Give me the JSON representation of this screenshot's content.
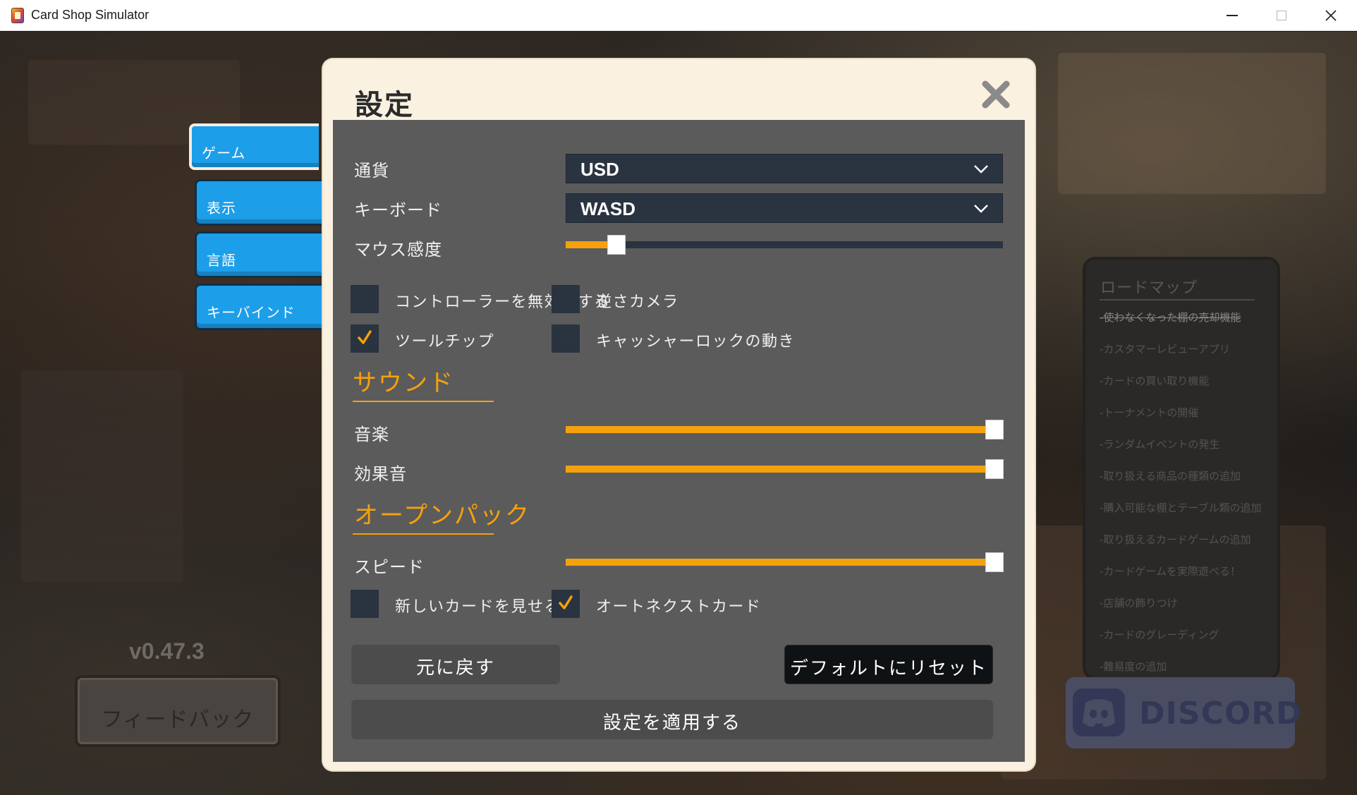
{
  "window": {
    "title": "Card Shop Simulator"
  },
  "tabs": [
    {
      "label": "ゲーム",
      "active": true
    },
    {
      "label": "表示",
      "active": false
    },
    {
      "label": "言語",
      "active": false
    },
    {
      "label": "キーバインド",
      "active": false
    }
  ],
  "version": "v0.47.3",
  "feedback_label": "フィードバック",
  "roadmap": {
    "title": "ロードマップ",
    "items": [
      "-使わなくなった棚の売却機能",
      "-カスタマーレビューアプリ",
      "-カードの買い取り機能",
      "-トーナメントの開催",
      "-ランダムイベントの発生",
      "-取り扱える商品の種類の追加",
      "-購入可能な棚とテーブル類の追加",
      "-取り扱えるカードゲームの追加",
      "-カードゲームを実際遊べる！",
      "-店舗の飾りつけ",
      "-カードのグレーディング",
      "-難易度の追加"
    ]
  },
  "discord_label": "DISCORD",
  "settings": {
    "title": "設定",
    "currency": {
      "label": "通貨",
      "value": "USD"
    },
    "keyboard": {
      "label": "キーボード",
      "value": "WASD"
    },
    "mouse_sensitivity": {
      "label": "マウス感度",
      "level": 0.1
    },
    "disable_controller": {
      "label": "コントローラーを無効にする",
      "checked": false
    },
    "invert_camera": {
      "label": "逆さカメラ",
      "checked": false
    },
    "tooltip": {
      "label": "ツールチップ",
      "checked": true
    },
    "cashier_lock": {
      "label": "キャッシャーロックの動き",
      "checked": false
    },
    "sound_section": "サウンド",
    "music": {
      "label": "音楽",
      "level": 1.0
    },
    "sfx": {
      "label": "効果音",
      "level": 1.0
    },
    "open_pack_section": "オープンパック",
    "speed": {
      "label": "スピード",
      "level": 1.0
    },
    "show_new_cards": {
      "label": "新しいカードを見せる",
      "checked": false
    },
    "auto_next_card": {
      "label": "オートネクストカード",
      "checked": true
    },
    "revert_label": "元に戻す",
    "reset_label": "デフォルトにリセット",
    "apply_label": "設定を適用する"
  },
  "colors": {
    "accent": "#f5a10c",
    "tab_blue": "#1d9ee9",
    "panel": "#5b5b5b",
    "control_dark": "#2a3340",
    "dialog_frame": "#faf1e1"
  },
  "icons": [
    "app-icon",
    "close-icon",
    "chevron-down-icon",
    "check-icon",
    "discord-icon",
    "minimize-icon",
    "maximize-icon"
  ]
}
